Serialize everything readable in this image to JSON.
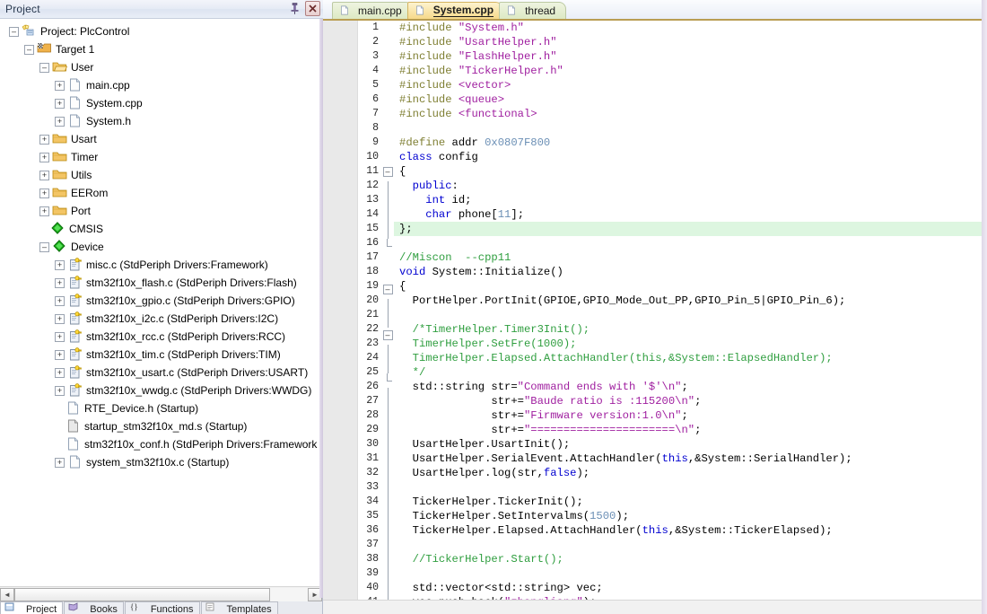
{
  "panel": {
    "title": "Project",
    "pin_icon": "pin-icon",
    "close_icon": "close-icon",
    "close_glyph": "✕"
  },
  "tree": [
    {
      "depth": 0,
      "expander": "minus",
      "icon": "project-icon",
      "label": "Project: PlcControl"
    },
    {
      "depth": 1,
      "expander": "minus",
      "icon": "target-icon",
      "label": "Target 1"
    },
    {
      "depth": 2,
      "expander": "minus",
      "icon": "folder-open-icon",
      "label": "User"
    },
    {
      "depth": 3,
      "expander": "plus",
      "icon": "file-icon",
      "label": "main.cpp"
    },
    {
      "depth": 3,
      "expander": "plus",
      "icon": "file-icon",
      "label": "System.cpp"
    },
    {
      "depth": 3,
      "expander": "plus",
      "icon": "file-icon",
      "label": "System.h"
    },
    {
      "depth": 2,
      "expander": "plus",
      "icon": "folder-icon",
      "label": "Usart"
    },
    {
      "depth": 2,
      "expander": "plus",
      "icon": "folder-icon",
      "label": "Timer"
    },
    {
      "depth": 2,
      "expander": "plus",
      "icon": "folder-icon",
      "label": "Utils"
    },
    {
      "depth": 2,
      "expander": "plus",
      "icon": "folder-icon",
      "label": "EERom"
    },
    {
      "depth": 2,
      "expander": "plus",
      "icon": "folder-icon",
      "label": "Port"
    },
    {
      "depth": 2,
      "expander": "none",
      "icon": "cmsis-icon",
      "label": "CMSIS"
    },
    {
      "depth": 2,
      "expander": "minus",
      "icon": "device-icon",
      "label": "Device"
    },
    {
      "depth": 3,
      "expander": "plus",
      "icon": "csource-icon",
      "label": "misc.c (StdPeriph Drivers:Framework)"
    },
    {
      "depth": 3,
      "expander": "plus",
      "icon": "csource-icon",
      "label": "stm32f10x_flash.c (StdPeriph Drivers:Flash)"
    },
    {
      "depth": 3,
      "expander": "plus",
      "icon": "csource-icon",
      "label": "stm32f10x_gpio.c (StdPeriph Drivers:GPIO)"
    },
    {
      "depth": 3,
      "expander": "plus",
      "icon": "csource-icon",
      "label": "stm32f10x_i2c.c (StdPeriph Drivers:I2C)"
    },
    {
      "depth": 3,
      "expander": "plus",
      "icon": "csource-icon",
      "label": "stm32f10x_rcc.c (StdPeriph Drivers:RCC)"
    },
    {
      "depth": 3,
      "expander": "plus",
      "icon": "csource-icon",
      "label": "stm32f10x_tim.c (StdPeriph Drivers:TIM)"
    },
    {
      "depth": 3,
      "expander": "plus",
      "icon": "csource-icon",
      "label": "stm32f10x_usart.c (StdPeriph Drivers:USART)"
    },
    {
      "depth": 3,
      "expander": "plus",
      "icon": "csource-icon",
      "label": "stm32f10x_wwdg.c (StdPeriph Drivers:WWDG)"
    },
    {
      "depth": 3,
      "expander": "none",
      "icon": "file-icon",
      "label": "RTE_Device.h (Startup)"
    },
    {
      "depth": 3,
      "expander": "none",
      "icon": "asm-icon",
      "label": "startup_stm32f10x_md.s (Startup)"
    },
    {
      "depth": 3,
      "expander": "none",
      "icon": "file-icon",
      "label": "stm32f10x_conf.h (StdPeriph Drivers:Framework"
    },
    {
      "depth": 3,
      "expander": "plus",
      "icon": "file-icon",
      "label": "system_stm32f10x.c (Startup)"
    }
  ],
  "bottom_tabs": [
    {
      "label": "Project",
      "icon": "project-tab-icon",
      "active": true
    },
    {
      "label": "Books",
      "icon": "books-tab-icon",
      "active": false
    },
    {
      "label": "Functions",
      "icon": "functions-tab-icon",
      "active": false
    },
    {
      "label": "Templates",
      "icon": "templates-tab-icon",
      "active": false
    }
  ],
  "scrollbar": {
    "left_arrow": "◄",
    "right_arrow": "►"
  },
  "editor_tabs": [
    {
      "label": "main.cpp",
      "icon": "file-icon",
      "state": "inactive"
    },
    {
      "label": "System.cpp",
      "icon": "file-icon",
      "state": "active"
    },
    {
      "label": "thread",
      "icon": "file-icon",
      "state": "inactive"
    }
  ],
  "colors": {
    "preprocessor": "#7f7f33",
    "string": "#a020a0",
    "keyword": "#0000d0",
    "number": "#6b8fb5",
    "comment": "#2f9e3f",
    "current_line_highlight": "#ddf6e0",
    "active_tab": "#f6d98a",
    "inactive_tab": "#dde9c4"
  },
  "code": {
    "first_line": 1,
    "lines": [
      {
        "n": 1,
        "fold": "none",
        "highlight": false,
        "tokens": [
          {
            "t": "pre",
            "s": "#include "
          },
          {
            "t": "str",
            "s": "\"System.h\""
          }
        ]
      },
      {
        "n": 2,
        "fold": "none",
        "highlight": false,
        "tokens": [
          {
            "t": "pre",
            "s": "#include "
          },
          {
            "t": "str",
            "s": "\"UsartHelper.h\""
          }
        ]
      },
      {
        "n": 3,
        "fold": "none",
        "highlight": false,
        "tokens": [
          {
            "t": "pre",
            "s": "#include "
          },
          {
            "t": "str",
            "s": "\"FlashHelper.h\""
          }
        ]
      },
      {
        "n": 4,
        "fold": "none",
        "highlight": false,
        "tokens": [
          {
            "t": "pre",
            "s": "#include "
          },
          {
            "t": "str",
            "s": "\"TickerHelper.h\""
          }
        ]
      },
      {
        "n": 5,
        "fold": "none",
        "highlight": false,
        "tokens": [
          {
            "t": "pre",
            "s": "#include "
          },
          {
            "t": "str",
            "s": "<vector>"
          }
        ]
      },
      {
        "n": 6,
        "fold": "none",
        "highlight": false,
        "tokens": [
          {
            "t": "pre",
            "s": "#include "
          },
          {
            "t": "str",
            "s": "<queue>"
          }
        ]
      },
      {
        "n": 7,
        "fold": "none",
        "highlight": false,
        "tokens": [
          {
            "t": "pre",
            "s": "#include "
          },
          {
            "t": "str",
            "s": "<functional>"
          }
        ]
      },
      {
        "n": 8,
        "fold": "none",
        "highlight": false,
        "tokens": []
      },
      {
        "n": 9,
        "fold": "none",
        "highlight": false,
        "tokens": [
          {
            "t": "pre",
            "s": "#define "
          },
          {
            "t": "plain",
            "s": "addr "
          },
          {
            "t": "num",
            "s": "0x0807F800"
          }
        ]
      },
      {
        "n": 10,
        "fold": "none",
        "highlight": false,
        "tokens": [
          {
            "t": "kw",
            "s": "class "
          },
          {
            "t": "plain",
            "s": "config"
          }
        ]
      },
      {
        "n": 11,
        "fold": "minus",
        "highlight": false,
        "tokens": [
          {
            "t": "plain",
            "s": "{"
          }
        ]
      },
      {
        "n": 12,
        "fold": "bar",
        "highlight": false,
        "tokens": [
          {
            "t": "plain",
            "s": "  "
          },
          {
            "t": "kw",
            "s": "public"
          },
          {
            "t": "plain",
            "s": ":"
          }
        ]
      },
      {
        "n": 13,
        "fold": "bar",
        "highlight": false,
        "tokens": [
          {
            "t": "plain",
            "s": "    "
          },
          {
            "t": "kw",
            "s": "int "
          },
          {
            "t": "plain",
            "s": "id;"
          }
        ]
      },
      {
        "n": 14,
        "fold": "bar",
        "highlight": false,
        "tokens": [
          {
            "t": "plain",
            "s": "    "
          },
          {
            "t": "kw",
            "s": "char "
          },
          {
            "t": "plain",
            "s": "phone["
          },
          {
            "t": "num",
            "s": "11"
          },
          {
            "t": "plain",
            "s": "];"
          }
        ]
      },
      {
        "n": 15,
        "fold": "bar",
        "highlight": true,
        "tokens": [
          {
            "t": "plain",
            "s": "};"
          }
        ]
      },
      {
        "n": 16,
        "fold": "end",
        "highlight": false,
        "tokens": []
      },
      {
        "n": 17,
        "fold": "none",
        "highlight": false,
        "tokens": [
          {
            "t": "cmt",
            "s": "//Miscon  --cpp11"
          }
        ]
      },
      {
        "n": 18,
        "fold": "none",
        "highlight": false,
        "tokens": [
          {
            "t": "kw",
            "s": "void "
          },
          {
            "t": "plain",
            "s": "System::Initialize()"
          }
        ]
      },
      {
        "n": 19,
        "fold": "minus",
        "highlight": false,
        "tokens": [
          {
            "t": "plain",
            "s": "{"
          }
        ]
      },
      {
        "n": 20,
        "fold": "bar",
        "highlight": false,
        "tokens": [
          {
            "t": "plain",
            "s": "  PortHelper.PortInit(GPIOE,GPIO_Mode_Out_PP,GPIO_Pin_5|GPIO_Pin_6);"
          }
        ]
      },
      {
        "n": 21,
        "fold": "bar",
        "highlight": false,
        "tokens": []
      },
      {
        "n": 22,
        "fold": "minus2",
        "highlight": false,
        "tokens": [
          {
            "t": "plain",
            "s": "  "
          },
          {
            "t": "cmt",
            "s": "/*TimerHelper.Timer3Init();"
          }
        ]
      },
      {
        "n": 23,
        "fold": "bar2",
        "highlight": false,
        "tokens": [
          {
            "t": "plain",
            "s": "  "
          },
          {
            "t": "cmt",
            "s": "TimerHelper.SetFre(1000);"
          }
        ]
      },
      {
        "n": 24,
        "fold": "bar2",
        "highlight": false,
        "tokens": [
          {
            "t": "plain",
            "s": "  "
          },
          {
            "t": "cmt",
            "s": "TimerHelper.Elapsed.AttachHandler(this,&System::ElapsedHandler);"
          }
        ]
      },
      {
        "n": 25,
        "fold": "end2",
        "highlight": false,
        "tokens": [
          {
            "t": "plain",
            "s": "  "
          },
          {
            "t": "cmt",
            "s": "*/"
          }
        ]
      },
      {
        "n": 26,
        "fold": "bar",
        "highlight": false,
        "tokens": [
          {
            "t": "plain",
            "s": "  std::string str="
          },
          {
            "t": "str",
            "s": "\"Command ends with '$'\\n\""
          },
          {
            "t": "plain",
            "s": ";"
          }
        ]
      },
      {
        "n": 27,
        "fold": "bar",
        "highlight": false,
        "tokens": [
          {
            "t": "plain",
            "s": "              str+="
          },
          {
            "t": "str",
            "s": "\"Baude ratio is :115200\\n\""
          },
          {
            "t": "plain",
            "s": ";"
          }
        ]
      },
      {
        "n": 28,
        "fold": "bar",
        "highlight": false,
        "tokens": [
          {
            "t": "plain",
            "s": "              str+="
          },
          {
            "t": "str",
            "s": "\"Firmware version:1.0\\n\""
          },
          {
            "t": "plain",
            "s": ";"
          }
        ]
      },
      {
        "n": 29,
        "fold": "bar",
        "highlight": false,
        "tokens": [
          {
            "t": "plain",
            "s": "              str+="
          },
          {
            "t": "str",
            "s": "\"======================\\n\""
          },
          {
            "t": "plain",
            "s": ";"
          }
        ]
      },
      {
        "n": 30,
        "fold": "bar",
        "highlight": false,
        "tokens": [
          {
            "t": "plain",
            "s": "  UsartHelper.UsartInit();"
          }
        ]
      },
      {
        "n": 31,
        "fold": "bar",
        "highlight": false,
        "tokens": [
          {
            "t": "plain",
            "s": "  UsartHelper.SerialEvent.AttachHandler("
          },
          {
            "t": "kw",
            "s": "this"
          },
          {
            "t": "plain",
            "s": ",&System::SerialHandler);"
          }
        ]
      },
      {
        "n": 32,
        "fold": "bar",
        "highlight": false,
        "tokens": [
          {
            "t": "plain",
            "s": "  UsartHelper.log(str,"
          },
          {
            "t": "kw",
            "s": "false"
          },
          {
            "t": "plain",
            "s": ");"
          }
        ]
      },
      {
        "n": 33,
        "fold": "bar",
        "highlight": false,
        "tokens": []
      },
      {
        "n": 34,
        "fold": "bar",
        "highlight": false,
        "tokens": [
          {
            "t": "plain",
            "s": "  TickerHelper.TickerInit();"
          }
        ]
      },
      {
        "n": 35,
        "fold": "bar",
        "highlight": false,
        "tokens": [
          {
            "t": "plain",
            "s": "  TickerHelper.SetIntervalms("
          },
          {
            "t": "num",
            "s": "1500"
          },
          {
            "t": "plain",
            "s": ");"
          }
        ]
      },
      {
        "n": 36,
        "fold": "bar",
        "highlight": false,
        "tokens": [
          {
            "t": "plain",
            "s": "  TickerHelper.Elapsed.AttachHandler("
          },
          {
            "t": "kw",
            "s": "this"
          },
          {
            "t": "plain",
            "s": ",&System::TickerElapsed);"
          }
        ]
      },
      {
        "n": 37,
        "fold": "bar",
        "highlight": false,
        "tokens": []
      },
      {
        "n": 38,
        "fold": "bar",
        "highlight": false,
        "tokens": [
          {
            "t": "plain",
            "s": "  "
          },
          {
            "t": "cmt",
            "s": "//TickerHelper.Start();"
          }
        ]
      },
      {
        "n": 39,
        "fold": "bar",
        "highlight": false,
        "tokens": []
      },
      {
        "n": 40,
        "fold": "bar",
        "highlight": false,
        "tokens": [
          {
            "t": "plain",
            "s": "  std::vector<std::string> vec;"
          }
        ]
      },
      {
        "n": 41,
        "fold": "bar",
        "highlight": false,
        "tokens": [
          {
            "t": "plain",
            "s": "  vec.push_back("
          },
          {
            "t": "str",
            "s": "\"zhangliang\""
          },
          {
            "t": "plain",
            "s": ");"
          }
        ]
      }
    ]
  }
}
